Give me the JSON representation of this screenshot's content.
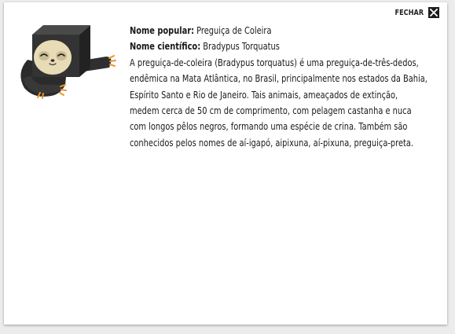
{
  "close": {
    "label": "FECHAR",
    "icon": "close-icon"
  },
  "animal": {
    "popular_label": "Nome popular:",
    "popular_value": "Preguiça de Coleira",
    "scientific_label": "Nome científico:",
    "scientific_value": "Bradypus Torquatus",
    "description_lines": [
      "A preguiça-de-coleira (Bradypus torquatus) é uma preguiça-de-três-dedos,",
      "endêmica na Mata Atlântica, no Brasil, principalmente nos estados da Bahia,",
      "Espírito Santo e Rio de Janeiro. Tais animais, ameaçados de extinção,",
      "medem cerca de 50 cm de comprimento, com pelagem castanha e nuca",
      "com longos pêlos negros, formando uma espécie de crina. Também são",
      "conhecidos pelos nomes de aí-igapó, aipixuna, aí-pixuna, preguiça-preta."
    ]
  },
  "colors": {
    "fur_dark": "#2b2b2b",
    "fur_mid": "#3a3a3a",
    "face": "#e8dcb6",
    "claws": "#e9962a"
  },
  "illustration": "sloth-illustration"
}
